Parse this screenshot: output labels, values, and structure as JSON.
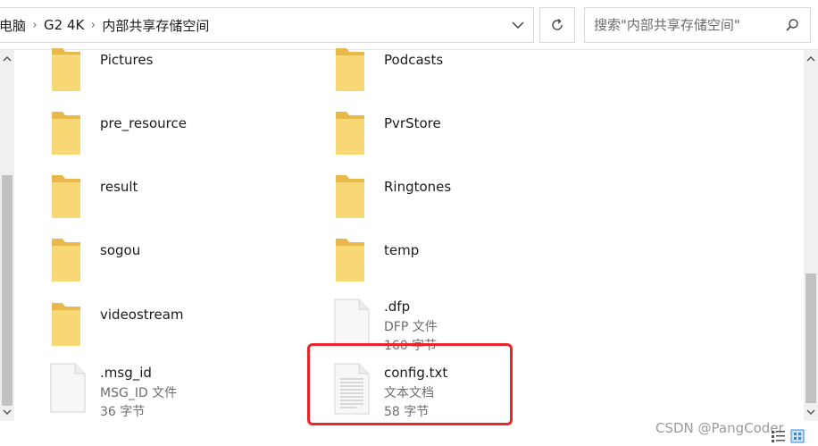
{
  "address": {
    "crumbs": [
      "电脑",
      "G2 4K",
      "内部共享存储空间"
    ]
  },
  "search": {
    "placeholder": "搜索\"内部共享存储空间\""
  },
  "items": [
    {
      "name": "Pictures",
      "kind": "folder"
    },
    {
      "name": "Podcasts",
      "kind": "folder"
    },
    {
      "name": "pre_resource",
      "kind": "folder"
    },
    {
      "name": "PvrStore",
      "kind": "folder"
    },
    {
      "name": "result",
      "kind": "folder"
    },
    {
      "name": "Ringtones",
      "kind": "folder"
    },
    {
      "name": "sogou",
      "kind": "folder"
    },
    {
      "name": "temp",
      "kind": "folder"
    },
    {
      "name": "videostream",
      "kind": "folder"
    },
    {
      "name": ".dfp",
      "kind": "file",
      "type": "DFP 文件",
      "size": "160 字节"
    },
    {
      "name": ".msg_id",
      "kind": "file",
      "type": "MSG_ID 文件",
      "size": "36 字节"
    },
    {
      "name": "config.txt",
      "kind": "textfile",
      "type": "文本文档",
      "size": "58 字节"
    }
  ],
  "watermark": "CSDN @PangCoder",
  "colors": {
    "folder": "#f8d775",
    "folder_dark": "#e8b84a",
    "highlight": "#e8262a"
  }
}
